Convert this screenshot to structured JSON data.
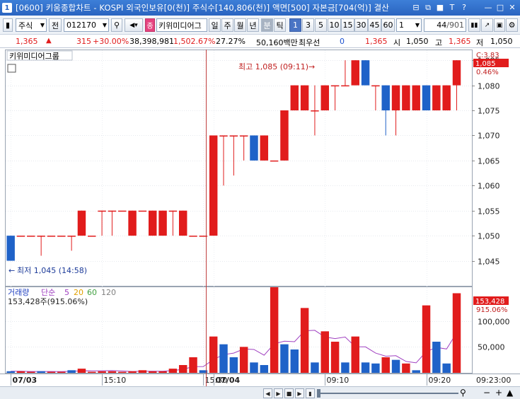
{
  "window": {
    "icon": "1",
    "title": "[0600] 키움종합차트 - KOSPI 외국인보유[0(천)] 주식수[140,806(천)] 액면[500] 자본금[704(억)] 결산",
    "buttons": [
      "⊟",
      "⧉",
      "■",
      "T",
      "?"
    ],
    "win_buttons": [
      "—",
      "□",
      "✕"
    ]
  },
  "toolbar": {
    "market": "주식",
    "market_btn": "전",
    "code": "012170",
    "badge": "종",
    "name": "키위미디어그",
    "periods": [
      "일",
      "주",
      "월",
      "년",
      "분",
      "틱"
    ],
    "selected_period": "분",
    "intervals": [
      "1",
      "3",
      "5",
      "10",
      "15",
      "30",
      "45",
      "60"
    ],
    "selected_interval": "1",
    "unit": "1",
    "page": "44",
    "page_total": "/901"
  },
  "quote": {
    "price": "1,365",
    "change": "315",
    "change_pct": "+30.00%",
    "volume": "38,398,981",
    "vol_ratio": "1,502.67%",
    "turnover": "27.27%",
    "amount": "50,160백만",
    "best_label": "최우선",
    "best_qty": "0",
    "ask": "1,365",
    "open_label": "시",
    "open": "1,050",
    "high_label": "고",
    "high": "1,365",
    "low_label": "저",
    "low": "1,050"
  },
  "chart_labels": {
    "name_tag": "키위미디어그룹",
    "max_note": "최고 1,085 (09:11)",
    "min_note": "최저 1,045 (14:58)",
    "right_price_tag": "1,085",
    "right_pct": "0.46%",
    "right_c": "C:3.83",
    "vol_tag": "153,428",
    "vol_pct": "915.06%",
    "vol_title": "거래량",
    "vol_ma_label": "단순",
    "vol_ma": [
      "5",
      "20",
      "60",
      "120"
    ],
    "vol_info": "153,428주(915.06%)",
    "time_axis_end": "09:23:00"
  },
  "colors": {
    "up": "#e11c1c",
    "down": "#1f62c8",
    "ma5": "#a040c0",
    "ma20": "#e0a000",
    "ma60": "#40a040",
    "ma120": "#808080",
    "cursor": "#c04040"
  },
  "chart_data": [
    {
      "type": "candlestick",
      "title": "키위미디어그룹",
      "ylim": [
        1040,
        1087
      ],
      "yticks": [
        1045,
        1050,
        1055,
        1060,
        1065,
        1070,
        1075,
        1080,
        1085
      ],
      "xticks": [
        "07/03",
        "15:10",
        "15:30",
        "07/04",
        "09:10",
        "09:20"
      ],
      "candles": [
        {
          "o": 1050,
          "h": 1050,
          "l": 1045,
          "c": 1045
        },
        {
          "o": 1050,
          "h": 1050,
          "l": 1050,
          "c": 1050
        },
        {
          "o": 1050,
          "h": 1050,
          "l": 1050,
          "c": 1050
        },
        {
          "o": 1050,
          "h": 1050,
          "l": 1046,
          "c": 1050
        },
        {
          "o": 1050,
          "h": 1050,
          "l": 1050,
          "c": 1050
        },
        {
          "o": 1050,
          "h": 1050,
          "l": 1050,
          "c": 1050
        },
        {
          "o": 1050,
          "h": 1050,
          "l": 1047,
          "c": 1050
        },
        {
          "o": 1050,
          "h": 1055,
          "l": 1050,
          "c": 1055
        },
        {
          "o": 1050,
          "h": 1050,
          "l": 1050,
          "c": 1050
        },
        {
          "o": 1055,
          "h": 1055,
          "l": 1050,
          "c": 1055
        },
        {
          "o": 1055,
          "h": 1055,
          "l": 1050,
          "c": 1055
        },
        {
          "o": 1055,
          "h": 1055,
          "l": 1055,
          "c": 1055
        },
        {
          "o": 1050,
          "h": 1055,
          "l": 1050,
          "c": 1055
        },
        {
          "o": 1055,
          "h": 1055,
          "l": 1055,
          "c": 1055
        },
        {
          "o": 1050,
          "h": 1055,
          "l": 1050,
          "c": 1055
        },
        {
          "o": 1050,
          "h": 1055,
          "l": 1050,
          "c": 1055
        },
        {
          "o": 1055,
          "h": 1055,
          "l": 1050,
          "c": 1055
        },
        {
          "o": 1050,
          "h": 1055,
          "l": 1050,
          "c": 1055
        },
        {
          "o": 1050,
          "h": 1050,
          "l": 1050,
          "c": 1050
        },
        {
          "o": 1050,
          "h": 1050,
          "l": 1050,
          "c": 1050
        },
        {
          "o": 1050,
          "h": 1070,
          "l": 1050,
          "c": 1070
        },
        {
          "o": 1070,
          "h": 1070,
          "l": 1060,
          "c": 1070
        },
        {
          "o": 1070,
          "h": 1070,
          "l": 1062,
          "c": 1070
        },
        {
          "o": 1070,
          "h": 1070,
          "l": 1065,
          "c": 1070
        },
        {
          "o": 1070,
          "h": 1070,
          "l": 1065,
          "c": 1065
        },
        {
          "o": 1065,
          "h": 1070,
          "l": 1065,
          "c": 1070
        },
        {
          "o": 1065,
          "h": 1065,
          "l": 1065,
          "c": 1065
        },
        {
          "o": 1065,
          "h": 1075,
          "l": 1065,
          "c": 1075
        },
        {
          "o": 1075,
          "h": 1080,
          "l": 1075,
          "c": 1080
        },
        {
          "o": 1075,
          "h": 1080,
          "l": 1075,
          "c": 1080
        },
        {
          "o": 1075,
          "h": 1080,
          "l": 1070,
          "c": 1075
        },
        {
          "o": 1075,
          "h": 1080,
          "l": 1075,
          "c": 1080
        },
        {
          "o": 1080,
          "h": 1080,
          "l": 1075,
          "c": 1080
        },
        {
          "o": 1080,
          "h": 1085,
          "l": 1080,
          "c": 1080
        },
        {
          "o": 1080,
          "h": 1085,
          "l": 1080,
          "c": 1085
        },
        {
          "o": 1085,
          "h": 1085,
          "l": 1080,
          "c": 1080
        },
        {
          "o": 1080,
          "h": 1080,
          "l": 1075,
          "c": 1080
        },
        {
          "o": 1080,
          "h": 1080,
          "l": 1070,
          "c": 1075
        },
        {
          "o": 1075,
          "h": 1080,
          "l": 1070,
          "c": 1080
        },
        {
          "o": 1075,
          "h": 1080,
          "l": 1075,
          "c": 1080
        },
        {
          "o": 1075,
          "h": 1080,
          "l": 1075,
          "c": 1080
        },
        {
          "o": 1080,
          "h": 1080,
          "l": 1075,
          "c": 1075
        },
        {
          "o": 1075,
          "h": 1080,
          "l": 1075,
          "c": 1080
        },
        {
          "o": 1075,
          "h": 1080,
          "l": 1075,
          "c": 1080
        },
        {
          "o": 1080,
          "h": 1085,
          "l": 1075,
          "c": 1085
        }
      ]
    },
    {
      "type": "bar",
      "title": "거래량",
      "ylim": [
        0,
        165000
      ],
      "yticks": [
        50000,
        100000
      ],
      "ytick_labels": [
        "50,000",
        "100,000"
      ],
      "values": [
        3000,
        3000,
        2000,
        3000,
        2000,
        2000,
        5000,
        8000,
        2000,
        3000,
        3000,
        2000,
        3000,
        5000,
        3000,
        3000,
        8000,
        15000,
        30000,
        5000,
        70000,
        55000,
        30000,
        50000,
        20000,
        15000,
        165000,
        55000,
        45000,
        125000,
        20000,
        80000,
        60000,
        20000,
        70000,
        20000,
        18000,
        30000,
        25000,
        18000,
        5000,
        130000,
        60000,
        18000,
        153428
      ],
      "directions": [
        "down",
        "up",
        "up",
        "down",
        "up",
        "up",
        "down",
        "up",
        "up",
        "up",
        "up",
        "up",
        "up",
        "up",
        "up",
        "up",
        "up",
        "up",
        "up",
        "down",
        "up",
        "down",
        "down",
        "up",
        "down",
        "down",
        "up",
        "down",
        "down",
        "up",
        "down",
        "up",
        "up",
        "down",
        "up",
        "down",
        "down",
        "up",
        "down",
        "up",
        "down",
        "up",
        "down",
        "down",
        "up"
      ],
      "ma5": [
        3000,
        3000,
        2600,
        2600,
        2600,
        2400,
        2800,
        4000,
        3800,
        4000,
        4200,
        3600,
        2600,
        3200,
        3200,
        3200,
        4400,
        6800,
        11800,
        12200,
        25600,
        35000,
        38000,
        46000,
        45000,
        34000,
        56000,
        61000,
        60000,
        81000,
        82000,
        69000,
        66000,
        69000,
        50000,
        50000,
        38000,
        32000,
        33000,
        22000,
        19200,
        41000,
        49000,
        46000,
        77000
      ]
    }
  ]
}
